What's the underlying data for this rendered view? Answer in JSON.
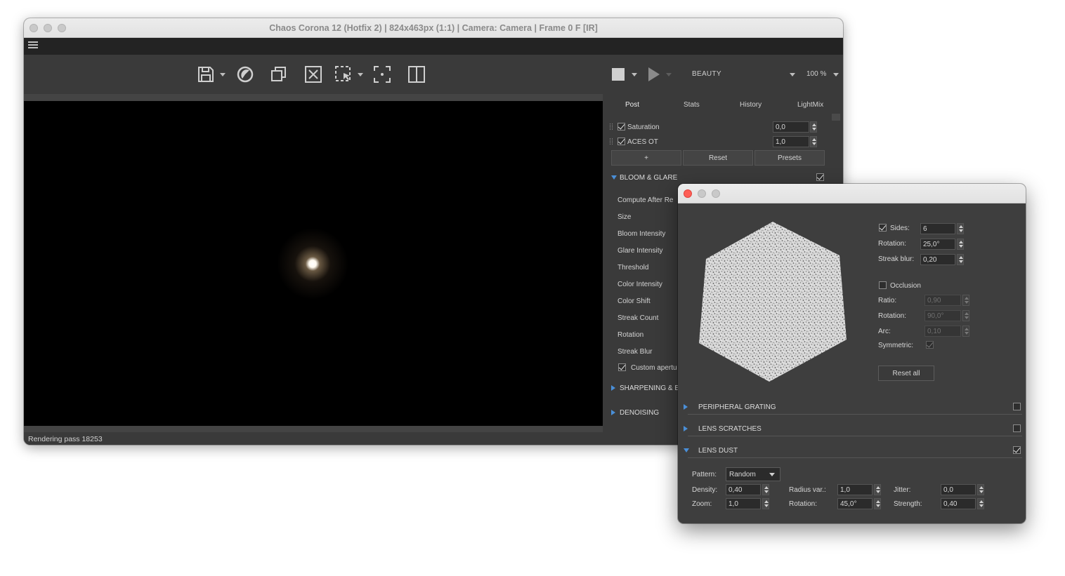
{
  "main_window": {
    "title": "Chaos Corona 12 (Hotfix 2) | 824x463px (1:1) | Camera: Camera | Frame 0 F [IR]",
    "status": "Rendering pass 18253",
    "toolbar": {
      "icons": [
        "save-icon",
        "corona-logo-icon",
        "copy-icon",
        "clear-icon",
        "region-select-icon",
        "focus-icon",
        "split-view-icon",
        "stop-icon",
        "play-icon"
      ],
      "channel": "BEAUTY",
      "zoom": "100 %"
    }
  },
  "panel": {
    "tabs": [
      "Post",
      "Stats",
      "History",
      "LightMix"
    ],
    "operators": [
      {
        "label": "Saturation",
        "value": "0,0",
        "checked": true
      },
      {
        "label": "ACES OT",
        "value": "1,0",
        "checked": true
      }
    ],
    "buttons": {
      "add": "+",
      "reset": "Reset",
      "presets": "Presets"
    },
    "bloom_glare": {
      "title": "BLOOM & GLARE",
      "enabled": true,
      "rows": [
        "Compute After Re",
        "Size",
        "Bloom Intensity",
        "Glare Intensity",
        "Threshold",
        "Color Intensity",
        "Color Shift",
        "Streak Count",
        "Rotation",
        "Streak Blur"
      ],
      "custom_aperture": "Custom apertu"
    },
    "sections": [
      "SHARPENING & B",
      "DENOISING"
    ]
  },
  "dialog": {
    "aperture": {
      "sides_label": "Sides:",
      "sides": "6",
      "rotation_label": "Rotation:",
      "rotation": "25,0°",
      "streak_blur_label": "Streak blur:",
      "streak_blur": "0,20",
      "occlusion_label": "Occlusion",
      "ratio_label": "Ratio:",
      "ratio": "0,90",
      "occ_rotation_label": "Rotation:",
      "occ_rotation": "90,0°",
      "arc_label": "Arc:",
      "arc": "0,10",
      "symmetric_label": "Symmetric:",
      "reset_all": "Reset all"
    },
    "sections": [
      {
        "title": "PERIPHERAL GRATING",
        "enabled": false
      },
      {
        "title": "LENS SCRATCHES",
        "enabled": false
      },
      {
        "title": "LENS DUST",
        "enabled": true
      }
    ],
    "lens_dust": {
      "pattern_label": "Pattern:",
      "pattern": "Random",
      "density_label": "Density:",
      "density": "0,40",
      "zoom_label": "Zoom:",
      "zoom": "1,0",
      "radius_var_label": "Radius var.:",
      "radius_var": "1,0",
      "rotation_label": "Rotation:",
      "rotation": "45,0°",
      "jitter_label": "Jitter:",
      "jitter": "0,0",
      "strength_label": "Strength:",
      "strength": "0,40"
    }
  }
}
